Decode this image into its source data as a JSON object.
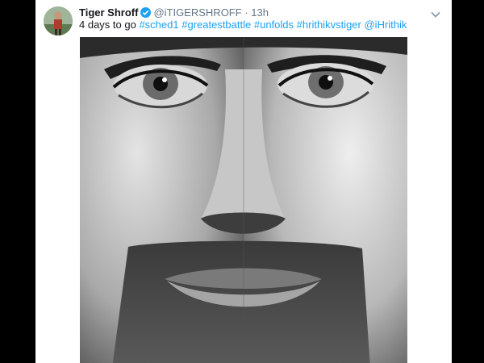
{
  "tweet": {
    "author_name": "Tiger Shroff",
    "handle": "@iTIGERSHROFF",
    "separator": "·",
    "time": "13h",
    "text_prefix": "4 days to go",
    "hashtags": [
      "#sched1",
      "#greatestbattle",
      "#unfolds",
      "#hrithikvstiger"
    ],
    "mention": "@iHrithik"
  },
  "icons": {
    "verified": "verified-badge-icon",
    "menu": "chevron-down-icon"
  },
  "colors": {
    "link": "#1da1f2",
    "secondary_text": "#657786",
    "primary_text": "#14171a",
    "letterbox": "#000000"
  }
}
